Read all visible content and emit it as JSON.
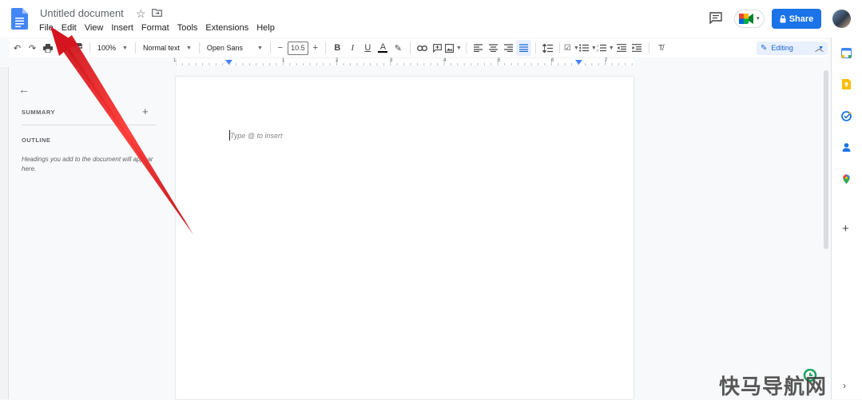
{
  "header": {
    "doc_title": "Untitled document",
    "share_label": "Share",
    "menu": [
      {
        "label": "File"
      },
      {
        "label": "Edit"
      },
      {
        "label": "View"
      },
      {
        "label": "Insert"
      },
      {
        "label": "Format"
      },
      {
        "label": "Tools"
      },
      {
        "label": "Extensions"
      },
      {
        "label": "Help"
      }
    ]
  },
  "toolbar": {
    "zoom": "100%",
    "style": "Normal text",
    "font": "Open Sans",
    "font_size": "10.5",
    "minus": "−",
    "plus": "+",
    "mode": "Editing"
  },
  "ruler": {
    "numbers": [
      "1",
      "1",
      "2",
      "3",
      "4",
      "5",
      "6",
      "7"
    ]
  },
  "outline": {
    "summary_label": "SUMMARY",
    "outline_label": "OUTLINE",
    "hint": "Headings you add to the document will appear here."
  },
  "document": {
    "placeholder": "Type @ to insert"
  },
  "watermark": {
    "text": "快马导航网"
  },
  "colors": {
    "accent": "#1a73e8",
    "arrow": "#e8191e",
    "docs_blue": "#4285f4"
  },
  "icons": {
    "undo": "undo-icon",
    "redo": "redo-icon",
    "print": "print-icon",
    "spellcheck": "spellcheck-icon",
    "paint_format": "paint-format-icon",
    "bold": "bold-icon",
    "italic": "italic-icon",
    "underline": "underline-icon",
    "text_color": "text-color-icon",
    "highlight": "highlight-icon",
    "link": "link-icon",
    "comment": "add-comment-icon",
    "image": "insert-image-icon"
  }
}
